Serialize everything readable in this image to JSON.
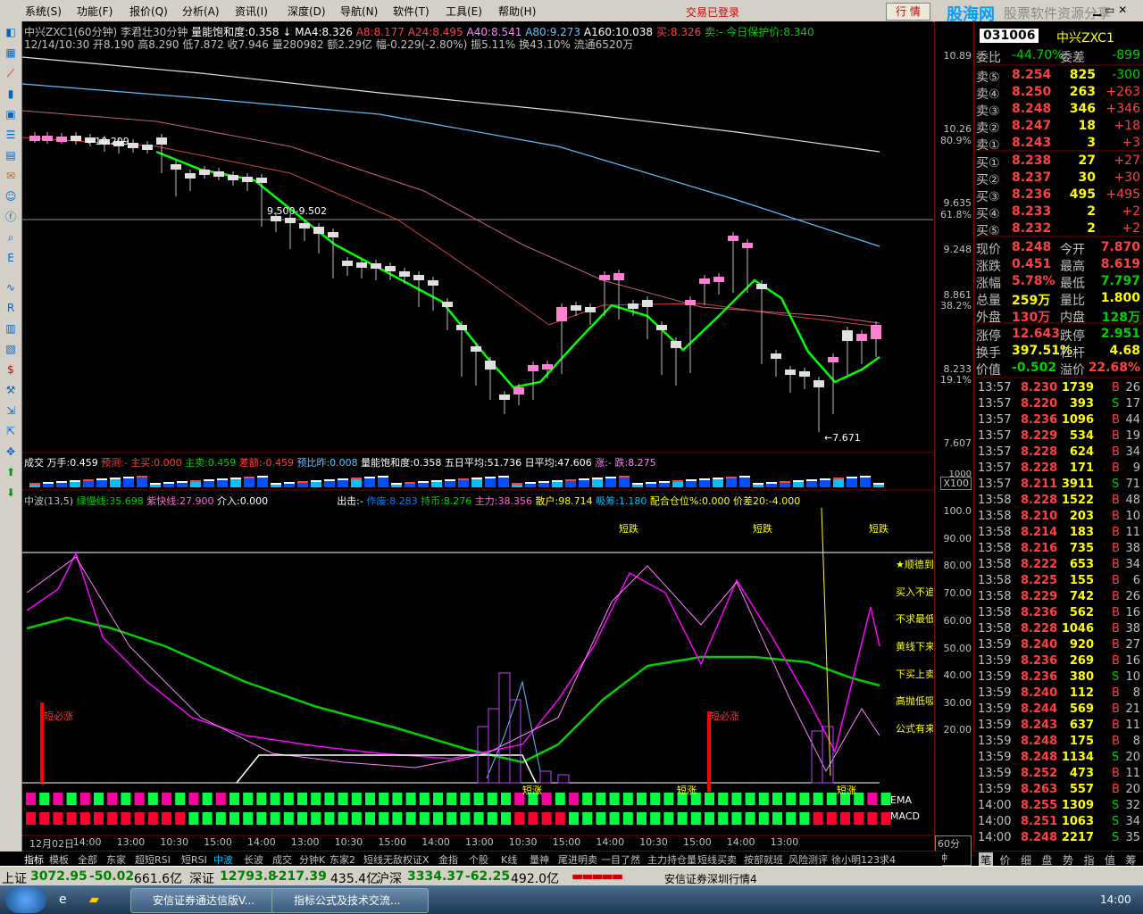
{
  "menu": {
    "items": [
      "系统(S)",
      "功能(F)",
      "报价(Q)",
      "分析(A)",
      "资讯(I)",
      "深度(D)",
      "导航(N)",
      "软件(T)",
      "工具(E)",
      "帮助(H)"
    ],
    "login_status": "交易已登录",
    "trade_button": "行 情",
    "brand": "股海网",
    "brand_sub": "股票软件资源分享"
  },
  "main_chart": {
    "title": "中兴ZXC1(60分钟)",
    "indicator_name": "李君壮30分钟",
    "sat": "量能饱和度:0.358",
    "ma4": "MA4:8.326",
    "a8": "A8:8.177",
    "a24": "A24:8.495",
    "a40": "A40:8.541",
    "a80": "A80:9.273",
    "a160": "A160:10.038",
    "sell": "买:8.326",
    "sell2": "卖:-  今日保护价:8.340",
    "ohlc": "12/14/10:30 开8.190 高8.290 低7.872 收7.946 量280982 额2.29亿 幅-0.229(-2.80%) 振5.11% 换43.10% 流通6520万",
    "label_high": "←10.209",
    "label_mid": "9.500-9.502",
    "label_low": "←7.671",
    "axis": [
      "10.89",
      "10.26",
      "80.9%",
      "9.635",
      "61.8%",
      "9.248",
      "8.861",
      "38.2%",
      "8.233",
      "19.1%",
      "7.607"
    ]
  },
  "vol_chart": {
    "line1": "成交  万手:0.459",
    "yc": "预测:-",
    "zs": "主买:0.000",
    "zm": "主卖:0.459",
    "ce": "差额:-0.459",
    "yb": "预比昨:0.008",
    "sat": "量能饱和度:0.358",
    "wr": "五日平均:51.736",
    "dr": "日平均:47.606",
    "zd": "涨:-  跌:8.275",
    "axis_unit": "X100",
    "axis_top": "1000"
  },
  "lower_chart": {
    "title": "中波(13,5)",
    "green": "绿慢线:35.698",
    "purple": "紫快线:27.900",
    "jr": "介入:0.000",
    "cx": "出击:-",
    "zf": "作废:8.283",
    "cb": "持币:8.276",
    "zl": "主力:38.356",
    "sh": "散户:98.714",
    "xc": "吸筹:1.180",
    "ph": "配合仓位%:0.000",
    "jc": "价差20:-4.000",
    "axis": [
      "100.0",
      "90.00",
      "80.00",
      "70.00",
      "60.00",
      "50.00",
      "40.00",
      "30.00",
      "20.00"
    ],
    "short_drop": "短跌",
    "short_rise": "短涨",
    "must_rise": "短必涨",
    "right_notes": [
      "★顺德到",
      "买入不追",
      "不求最低",
      "黄线下来",
      "下买上卖",
      "高抛低吸",
      "公式有来"
    ],
    "ema": "EMA",
    "macd": "MACD",
    "dates": [
      "12月02日",
      "14:00",
      "13:00",
      "10:30",
      "15:00",
      "14:00",
      "13:00",
      "10:30",
      "15:00",
      "14:00",
      "13:00",
      "10:30",
      "15:00",
      "14:00",
      "10:30",
      "15:00",
      "14:00",
      "13:00"
    ],
    "period": "60分钟"
  },
  "quote": {
    "code": "031006",
    "name": "中兴ZXC1",
    "wb_label": "委比",
    "wb": "-44.70%",
    "wc_label": "委差",
    "wc": "-899",
    "sells": [
      {
        "label": "卖⑤",
        "price": "8.254",
        "vol": "825",
        "chg": "-300"
      },
      {
        "label": "卖④",
        "price": "8.250",
        "vol": "263",
        "chg": "+263"
      },
      {
        "label": "卖③",
        "price": "8.248",
        "vol": "346",
        "chg": "+346"
      },
      {
        "label": "卖②",
        "price": "8.247",
        "vol": "18",
        "chg": "+18"
      },
      {
        "label": "卖①",
        "price": "8.243",
        "vol": "3",
        "chg": "+3"
      }
    ],
    "buys": [
      {
        "label": "买①",
        "price": "8.238",
        "vol": "27",
        "chg": "+27"
      },
      {
        "label": "买②",
        "price": "8.237",
        "vol": "30",
        "chg": "+30"
      },
      {
        "label": "买③",
        "price": "8.236",
        "vol": "495",
        "chg": "+495"
      },
      {
        "label": "买④",
        "price": "8.233",
        "vol": "2",
        "chg": "+2"
      },
      {
        "label": "买⑤",
        "price": "8.232",
        "vol": "2",
        "chg": "+2"
      }
    ],
    "stats": [
      {
        "l1": "现价",
        "v1": "8.248",
        "l2": "今开",
        "v2": "7.870"
      },
      {
        "l1": "涨跌",
        "v1": "0.451",
        "l2": "最高",
        "v2": "8.619"
      },
      {
        "l1": "涨幅",
        "v1": "5.78%",
        "l2": "最低",
        "v2": "7.797"
      },
      {
        "l1": "总量",
        "v1": "259万",
        "l2": "量比",
        "v2": "1.800"
      },
      {
        "l1": "外盘",
        "v1": "130万",
        "l2": "内盘",
        "v2": "128万"
      }
    ],
    "stats2": [
      {
        "l1": "涨停",
        "v1": "12.643",
        "l2": "跌停",
        "v2": "2.951"
      },
      {
        "l1": "换手",
        "v1": "397.51%",
        "l2": "杠杆",
        "v2": "4.68"
      },
      {
        "l1": "价值",
        "v1": "-0.502",
        "l2": "溢价",
        "v2": "22.68%"
      }
    ],
    "ticks": [
      [
        "13:57",
        "8.230",
        "1739",
        "B",
        "26"
      ],
      [
        "13:57",
        "8.220",
        "393",
        "S",
        "17"
      ],
      [
        "13:57",
        "8.236",
        "1096",
        "B",
        "44"
      ],
      [
        "13:57",
        "8.229",
        "534",
        "B",
        "19"
      ],
      [
        "13:57",
        "8.228",
        "624",
        "B",
        "34"
      ],
      [
        "13:57",
        "8.228",
        "171",
        "B",
        "9"
      ],
      [
        "13:57",
        "8.211",
        "3911",
        "S",
        "71"
      ],
      [
        "13:58",
        "8.228",
        "1522",
        "B",
        "48"
      ],
      [
        "13:58",
        "8.210",
        "203",
        "B",
        "10"
      ],
      [
        "13:58",
        "8.214",
        "183",
        "B",
        "11"
      ],
      [
        "13:58",
        "8.216",
        "735",
        "B",
        "38"
      ],
      [
        "13:58",
        "8.222",
        "653",
        "B",
        "34"
      ],
      [
        "13:58",
        "8.225",
        "155",
        "B",
        "6"
      ],
      [
        "13:58",
        "8.229",
        "742",
        "B",
        "26"
      ],
      [
        "13:58",
        "8.236",
        "562",
        "B",
        "16"
      ],
      [
        "13:58",
        "8.228",
        "1046",
        "B",
        "38"
      ],
      [
        "13:59",
        "8.240",
        "920",
        "B",
        "27"
      ],
      [
        "13:59",
        "8.236",
        "269",
        "B",
        "16"
      ],
      [
        "13:59",
        "8.236",
        "380",
        "S",
        "10"
      ],
      [
        "13:59",
        "8.240",
        "112",
        "B",
        "8"
      ],
      [
        "13:59",
        "8.244",
        "569",
        "B",
        "21"
      ],
      [
        "13:59",
        "8.243",
        "637",
        "B",
        "11"
      ],
      [
        "13:59",
        "8.248",
        "175",
        "B",
        "8"
      ],
      [
        "13:59",
        "8.248",
        "1134",
        "S",
        "20"
      ],
      [
        "13:59",
        "8.252",
        "473",
        "B",
        "11"
      ],
      [
        "13:59",
        "8.263",
        "557",
        "B",
        "20"
      ],
      [
        "14:00",
        "8.255",
        "1309",
        "S",
        "32"
      ],
      [
        "14:00",
        "8.251",
        "1063",
        "S",
        "34"
      ],
      [
        "14:00",
        "8.248",
        "2217",
        "S",
        "35"
      ]
    ]
  },
  "tabs": [
    "指标",
    "模板",
    "全部",
    "东家",
    "超短RSI",
    "短RSI",
    "中波",
    "长波",
    "成交",
    "分钟K",
    "东家2",
    "短线无敌",
    "权证X",
    "金指",
    "个股",
    "K线",
    "量神",
    "尾进明卖",
    "一目了然",
    "主力持仓量",
    "短线买卖",
    "按部就班",
    "风险测评",
    "徐小明123求4"
  ],
  "panel_tabs": [
    "笔",
    "价",
    "细",
    "盘",
    "势",
    "指",
    "值",
    "筹"
  ],
  "statusbar": {
    "sh_label": "上证",
    "sh_val": "3072.95",
    "sh_chg": "-50.02",
    "sh_amt": "661.6亿",
    "sz_label": "深证",
    "sz_val": "12793.8",
    "sz_chg": "-217.39",
    "sz_amt": "435.4亿",
    "hs_label": "沪深",
    "hs_val": "3334.37",
    "hs_chg": "-62.25",
    "hs_amt": "492.0亿",
    "feed": "安信证券深圳行情4"
  },
  "taskbar": {
    "tasks": [
      "安信证券通达信版V...",
      "指标公式及技术交流..."
    ],
    "clock": "14:00"
  },
  "colors": {
    "up": "#ff3c3c",
    "down": "#00d000",
    "yellow": "#ffff00",
    "pink": "#ff66cc",
    "cyan": "#00c0ff",
    "border": "#800000"
  }
}
